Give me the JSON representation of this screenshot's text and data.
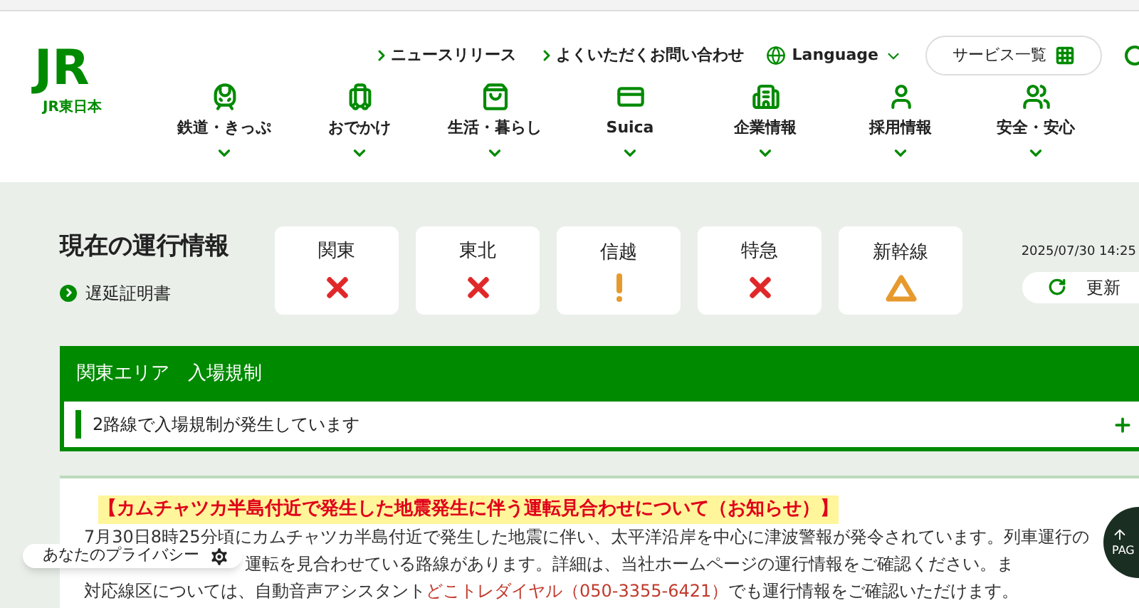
{
  "header": {
    "logo_text": "JR",
    "logo_caption": "JR東日本",
    "top_links": [
      {
        "label": "ニュースリリース"
      },
      {
        "label": "よくいただくお問い合わせ"
      }
    ],
    "language": {
      "label": "Language"
    },
    "services_button": {
      "label": "サービス一覧"
    },
    "nav": [
      {
        "label": "鉄道・きっぷ"
      },
      {
        "label": "おでかけ"
      },
      {
        "label": "生活・暮らし"
      },
      {
        "label": "Suica"
      },
      {
        "label": "企業情報"
      },
      {
        "label": "採用情報"
      },
      {
        "label": "安全・安心"
      }
    ]
  },
  "status": {
    "title": "現在の運行情報",
    "delay_certificate": "遅延証明書",
    "areas": [
      {
        "name": "関東",
        "kind": "cross"
      },
      {
        "name": "東北",
        "kind": "cross"
      },
      {
        "name": "信越",
        "kind": "exclamation"
      },
      {
        "name": "特急",
        "kind": "cross"
      },
      {
        "name": "新幹線",
        "kind": "triangle"
      }
    ],
    "timestamp": "2025/07/30 14:25",
    "refresh_button": "更新"
  },
  "alert_panel": {
    "title": "関東エリア　入場規制",
    "row": {
      "text": "2路線で入場規制が発生しています",
      "expanded": false
    }
  },
  "notice": {
    "headline": "【カムチャツカ半島付近で発生した地震発生に伴う運転見合わせについて（お知らせ）】",
    "lines": [
      {
        "text": "7月30日8時25分頃にカムチャツカ半島付近で発生した地震に伴い、太平洋沿岸を中心に津波警報が発令されています。列車運行の"
      },
      {
        "text": "運転を見合わせている路線があります。詳細は、当社ホームページの運行情報をご確認ください。ま"
      },
      {
        "text": "対応線区については、自動音声アシスタント",
        "link": "どこトレダイヤル（050-3355-6421）",
        "after": "でも運行情報をご確認いただけます。"
      }
    ]
  },
  "privacy_button": {
    "label": "あなたのプライバシー"
  },
  "page_top": {
    "label": "PAG"
  }
}
